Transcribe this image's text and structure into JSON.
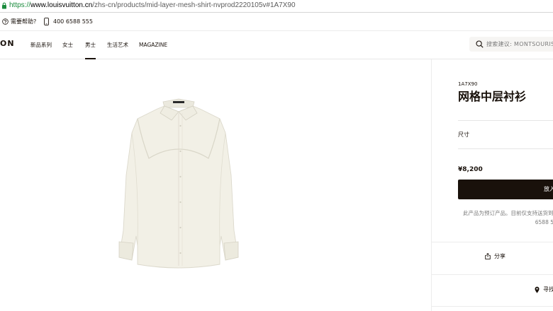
{
  "browser": {
    "url_scheme": "https://",
    "url_host": "www.louisvuitton.cn",
    "url_path": "/zhs-cn/products/mid-layer-mesh-shirt-nvprod2220105v#1A7X90"
  },
  "topbar": {
    "help_label": "需要帮助?",
    "phone_label": "400 6588 555"
  },
  "nav": {
    "logo_text": "ON",
    "items": [
      "新品系列",
      "女士",
      "男士",
      "生活艺术",
      "MAGAZINE"
    ],
    "active_index": 2,
    "search_placeholder": "搜索建议: MONTSOURIS"
  },
  "product": {
    "sku": "1A7X90",
    "title": "网格中层衬衫",
    "size_label": "尺寸",
    "price": "¥8,200",
    "add_to_cart_label": "放入",
    "notice_line1": "此产品为预订产品。目前仅支持送货到府",
    "notice_line2": "6588 5",
    "share_label": "分享",
    "find_label": "寻找"
  },
  "colors": {
    "brand_dark": "#19110b",
    "shirt": "#f2f0e6",
    "url_green": "#1a8b3c"
  }
}
